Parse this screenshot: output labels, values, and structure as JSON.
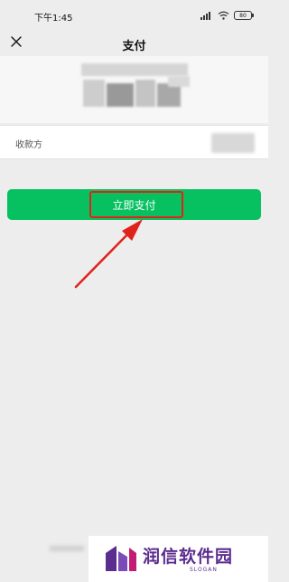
{
  "status_bar": {
    "time": "下午1:45",
    "battery": "80"
  },
  "nav": {
    "title": "支付",
    "close_icon": "close-icon"
  },
  "payee": {
    "label": "收款方"
  },
  "pay_button": {
    "label": "立即支付"
  },
  "watermark": {
    "title": "润信软件园",
    "slogan": "SLOGAN"
  },
  "colors": {
    "accent": "#07c160",
    "highlight": "#e0231a",
    "watermark": "#5b2d8e"
  }
}
